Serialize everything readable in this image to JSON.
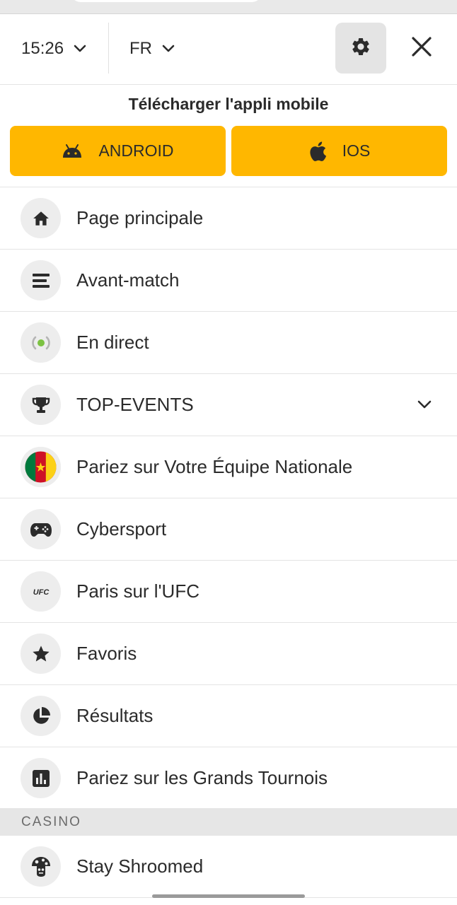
{
  "header": {
    "time": "15:26",
    "language": "FR"
  },
  "download": {
    "title": "Télécharger l'appli mobile",
    "android_label": "ANDROID",
    "ios_label": "IOS"
  },
  "menu": {
    "items": [
      {
        "label": "Page principale",
        "icon": "home-icon"
      },
      {
        "label": "Avant-match",
        "icon": "list-icon"
      },
      {
        "label": "En direct",
        "icon": "live-broadcast-icon"
      },
      {
        "label": "TOP-EVENTS",
        "icon": "trophy-icon"
      },
      {
        "label": "Pariez sur Votre Équipe Nationale",
        "icon": "cameroon-flag-icon"
      },
      {
        "label": "Cybersport",
        "icon": "gamepad-icon"
      },
      {
        "label": "Paris sur l'UFC",
        "icon": "ufc-logo-icon"
      },
      {
        "label": "Favoris",
        "icon": "star-icon"
      },
      {
        "label": "Résultats",
        "icon": "pie-chart-icon"
      },
      {
        "label": "Pariez sur les Grands Tournois",
        "icon": "bar-chart-icon"
      }
    ]
  },
  "casino": {
    "section_title": "CASINO",
    "items": [
      {
        "label": "Stay Shroomed",
        "icon": "mushroom-icon"
      }
    ]
  },
  "ufc_logo_text": "UFC",
  "colors": {
    "accent": "#ffb700",
    "live_green": "#7cc242",
    "flag_green": "#007a3d",
    "flag_red": "#ce1126",
    "flag_yellow": "#fcd116"
  }
}
